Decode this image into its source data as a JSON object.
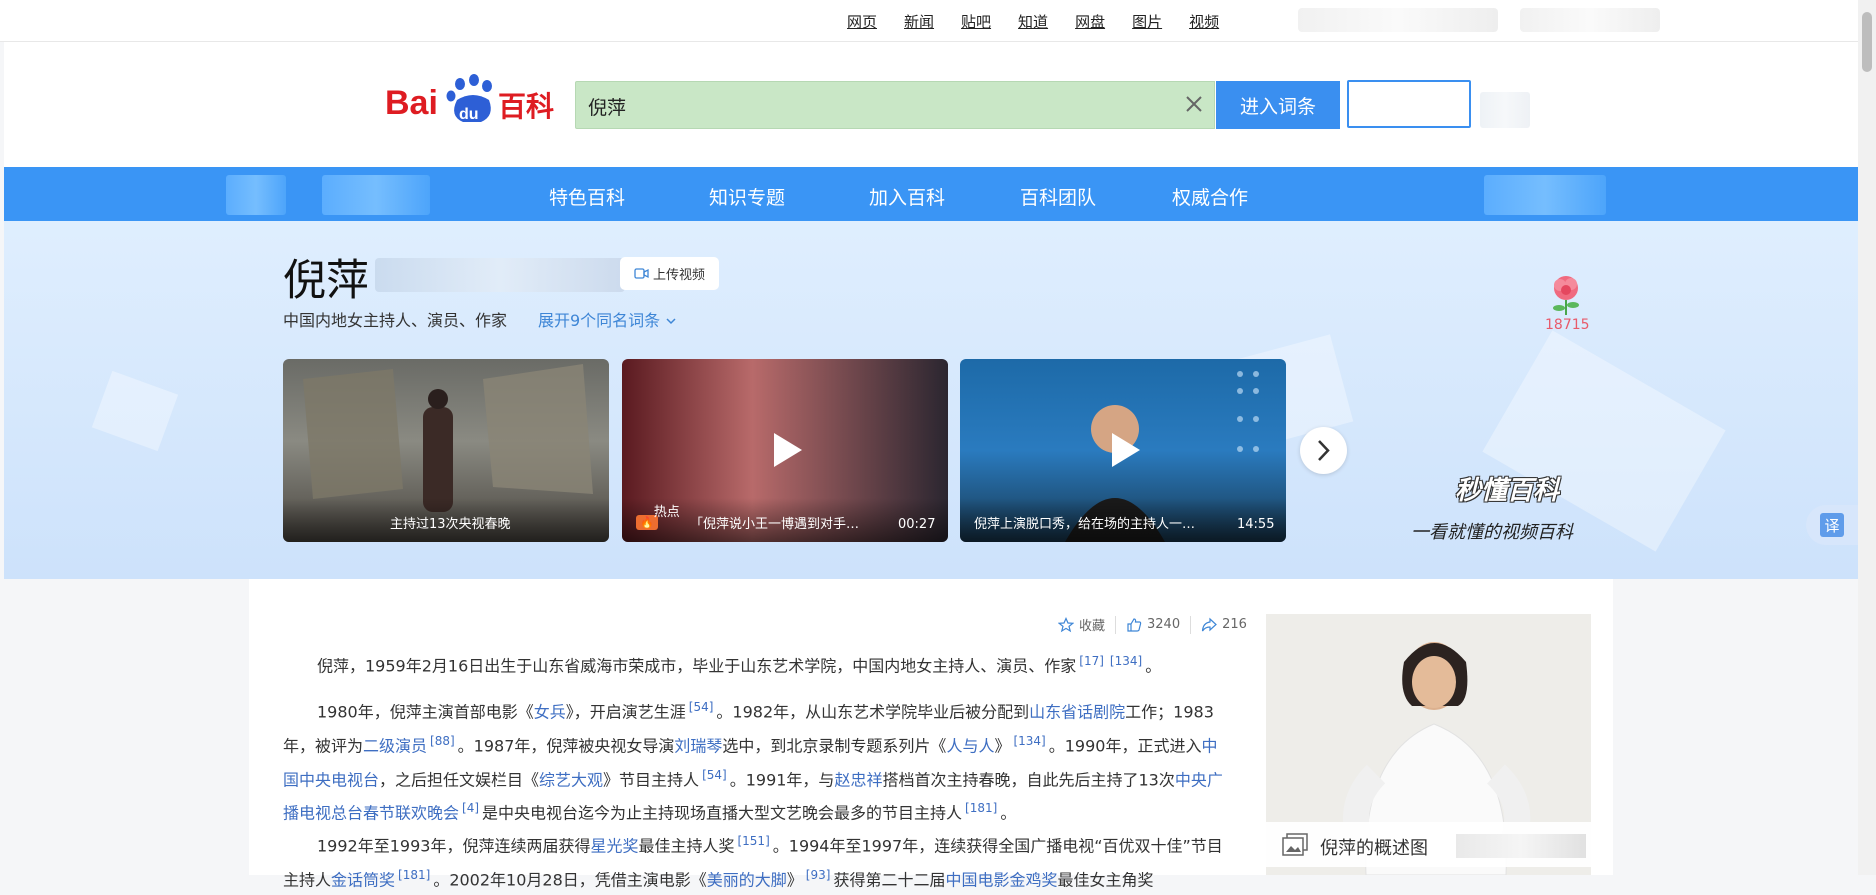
{
  "top_nav": {
    "links": [
      "网页",
      "新闻",
      "贴吧",
      "知道",
      "网盘",
      "图片",
      "视频"
    ]
  },
  "header": {
    "search_value": "倪萍",
    "enter_button": "进入词条"
  },
  "main_nav": {
    "items": [
      "特色百科",
      "知识专题",
      "加入百科",
      "百科团队",
      "权威合作"
    ]
  },
  "entry": {
    "title": "倪萍",
    "upload_video": "上传视频",
    "subtitle": "中国内地女主持人、演员、作家",
    "expand_link": "展开9个同名词条",
    "flower_count": "18715"
  },
  "videos": [
    {
      "caption": "主持过13次央视春晚",
      "duration": ""
    },
    {
      "badge": "热点",
      "caption": "「倪萍说小王一博遇到对手…",
      "duration": "00:27"
    },
    {
      "caption": "倪萍上演脱口秀，给在场的主持人一…",
      "duration": "14:55"
    }
  ],
  "brand": {
    "name": "秒懂百科",
    "slogan": "一看就懂的视频百科"
  },
  "actions": {
    "favorite": "收藏",
    "likes": "3240",
    "shares": "216"
  },
  "paragraphs": {
    "p1": {
      "t1": "倪萍，1959年2月16日出生于山东省威海市荣成市，毕业于山东艺术学院，中国内地女主持人、演员、作家",
      "r1": "[17]",
      "r2": "[134]",
      "t2": "。"
    },
    "p2": {
      "t1": "1980年，倪萍主演首部电影《",
      "l1": "女兵",
      "t2": "》，开启演艺生涯",
      "r1": "[54]",
      "t3": "。1982年，从山东艺术学院毕业后被分配到",
      "l2": "山东省话剧院",
      "t4": "工作；1983年，被评为",
      "l3": "二级演员",
      "r2": "[88]",
      "t5": "。1987年，倪萍被央视女导演",
      "l4": "刘瑞琴",
      "t6": "选中，到北京录制专题系列片《",
      "l5": "人与人",
      "t7": "》",
      "r3": "[134]",
      "t8": "。1990年，正式进入",
      "l6": "中国中央电视台",
      "t9": "，之后担任文娱栏目《",
      "l7": "综艺大观",
      "t10": "》节目主持人",
      "r4": "[54]",
      "t11": "。1991年，与",
      "l8": "赵忠祥",
      "t12": "搭档首次主持春晚，自此先后主持了13次",
      "l9": "中央广播电视总台春节联欢晚会",
      "r5": "[4]",
      "t13": "是中央电视台迄今为止主持现场直播大型文艺晚会最多的节目主持人",
      "r6": "[181]",
      "t14": "。"
    },
    "p3": {
      "t1": "1992年至1993年，倪萍连续两届获得",
      "l1": "星光奖",
      "t2": "最佳主持人奖",
      "r1": "[151]",
      "t3": "。1994年至1997年，连续获得全国广播电视“百优双十佳”节目主持人",
      "l2": "金话筒奖",
      "r2": "[181]",
      "t4": "。2002年10月28日，凭借主演电影《",
      "l3": "美丽的大脚",
      "t5": "》",
      "r3": "[93]",
      "t6": "获得第二十二届",
      "l4": "中国电影金鸡奖",
      "t7": "最佳女主角奖"
    }
  },
  "summary_image": {
    "caption": "倪萍的概述图"
  },
  "colors": {
    "brand_blue": "#3a95f5",
    "search_green": "#c9e7c6",
    "link_blue": "#3e6ec2",
    "flower_pink": "#e85a6b"
  }
}
